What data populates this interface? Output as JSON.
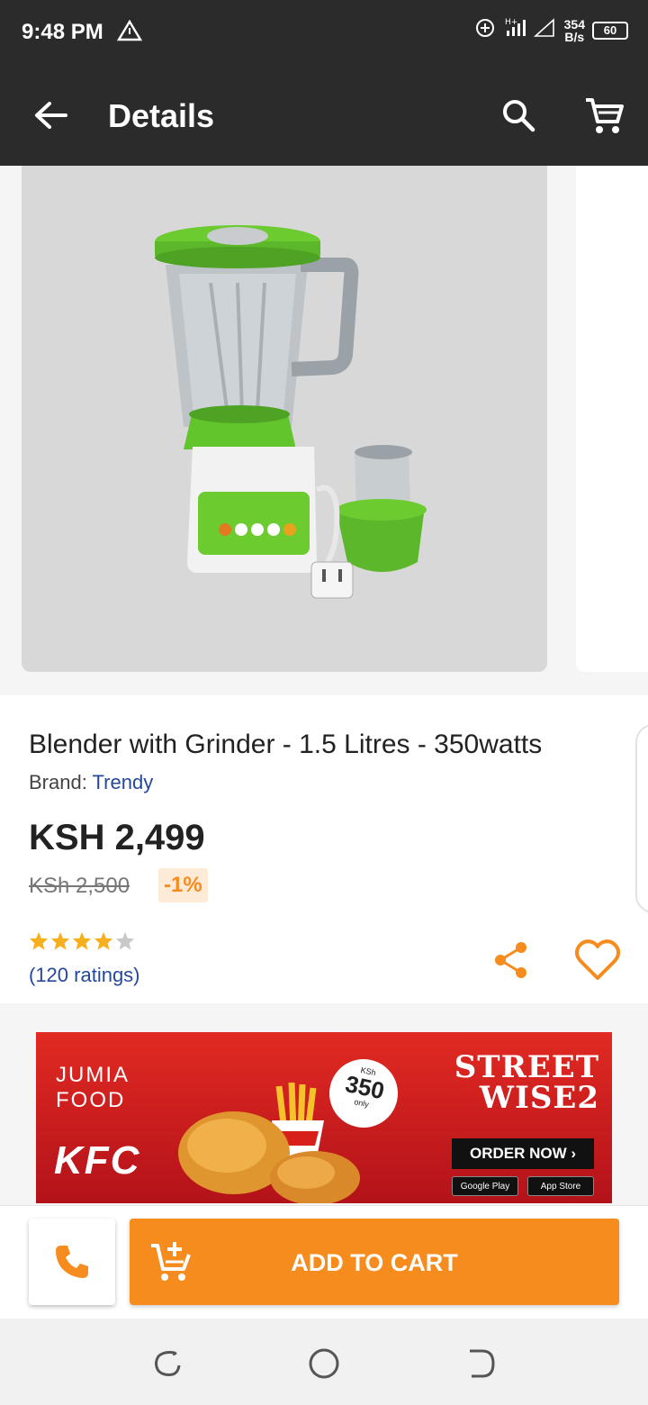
{
  "status_bar": {
    "time": "9:48 PM",
    "net_speed_value": "354",
    "net_speed_unit": "B/s",
    "battery": "60",
    "icons": [
      "alert-triangle-icon",
      "data-saver-icon",
      "signal-icon",
      "battery-icon"
    ]
  },
  "app_bar": {
    "title": "Details",
    "icons": [
      "back-arrow-icon",
      "search-icon",
      "cart-icon"
    ]
  },
  "product": {
    "title": "Blender with Grinder - 1.5 Litres - 350watts",
    "brand_label": "Brand:",
    "brand_name": "Trendy",
    "price": "KSH 2,499",
    "old_price": "KSh 2,500",
    "discount": "-1%",
    "rating": 4,
    "rating_max": 5,
    "ratings_count": "(120 ratings)"
  },
  "banner": {
    "brand_line1": "JUMIA",
    "brand_line2": "FOOD",
    "kfc": "KFC",
    "badge_top": "KSh",
    "badge_value": "350",
    "badge_bottom": "only",
    "headline_line1": "STREET",
    "headline_line2": "WISE2",
    "cta": "ORDER NOW ›",
    "store1": "Google Play",
    "store2": "App Store"
  },
  "actions": {
    "add_to_cart": "ADD TO CART",
    "icons": [
      "phone-icon",
      "add-to-cart-icon"
    ]
  },
  "colors": {
    "accent": "#f68b1e",
    "link": "#26489a",
    "toolbar": "#2b2b2b"
  }
}
